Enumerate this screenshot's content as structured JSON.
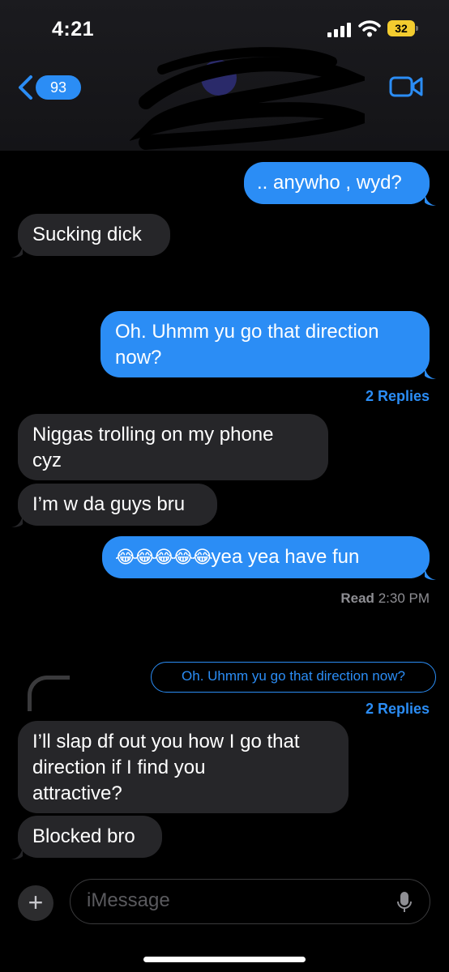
{
  "status_bar": {
    "time": "4:21",
    "battery": "32"
  },
  "header": {
    "unread_count": "93"
  },
  "messages": {
    "m1": ".. anywho , wyd?",
    "m2": "Sucking dick",
    "m3_line1": "Oh. Uhmm yu go that direction",
    "m3_line2": "now?",
    "m3_replies": "2 Replies",
    "m4_line1": " Niggas trolling on my phone",
    "m4_line2": "cyz",
    "m5": "I’m w da guys bru",
    "m6_emoji": "😂😂😂😂😂",
    "m6_text": "yea yea have fun",
    "read_label": "Read",
    "read_time": "2:30 PM",
    "quote": "Oh. Uhmm yu go that direction now?",
    "quote_replies": "2 Replies",
    "m7_line1": "I’ll slap df out you how I go that",
    "m7_line2": "direction if I find you",
    "m7_line3": "attractive?",
    "m8": "Blocked bro"
  },
  "compose": {
    "placeholder": "iMessage"
  },
  "colors": {
    "accent": "#2b8df5",
    "received_bubble": "#262629",
    "background": "#000000"
  }
}
